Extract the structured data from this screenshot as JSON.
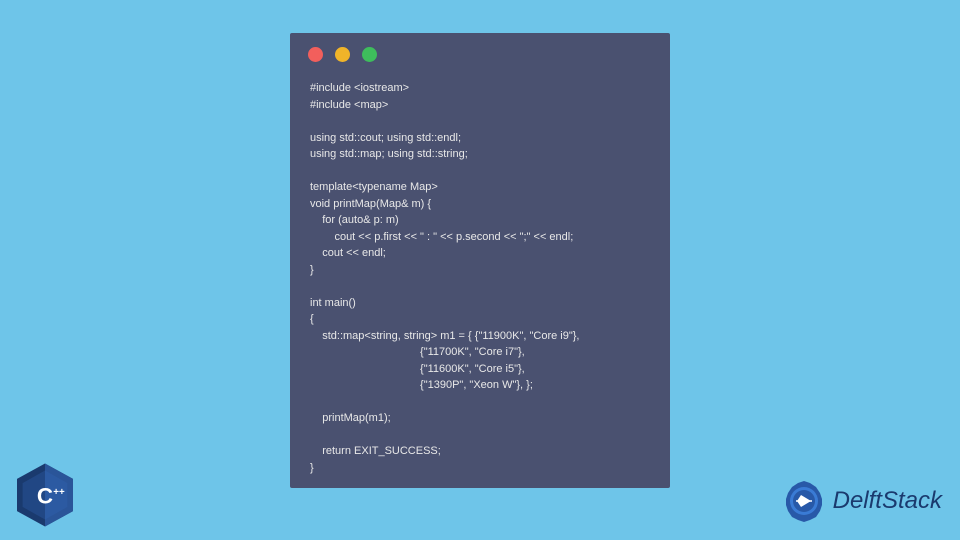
{
  "code": {
    "lines": [
      "#include <iostream>",
      "#include <map>",
      "",
      "using std::cout; using std::endl;",
      "using std::map; using std::string;",
      "",
      "template<typename Map>",
      "void printMap(Map& m) {",
      "    for (auto& p: m)",
      "        cout << p.first << \" : \" << p.second << \";\" << endl;",
      "    cout << endl;",
      "}",
      "",
      "int main()",
      "{",
      "    std::map<string, string> m1 = { {\"11900K\", \"Core i9\"},",
      "                                    {\"11700K\", \"Core i7\"},",
      "                                    {\"11600K\", \"Core i5\"},",
      "                                    {\"1390P\", \"Xeon W\"}, };",
      "",
      "    printMap(m1);",
      "",
      "    return EXIT_SUCCESS;",
      "}"
    ]
  },
  "badge": {
    "label": "C++"
  },
  "brand": {
    "name": "DelftStack"
  }
}
